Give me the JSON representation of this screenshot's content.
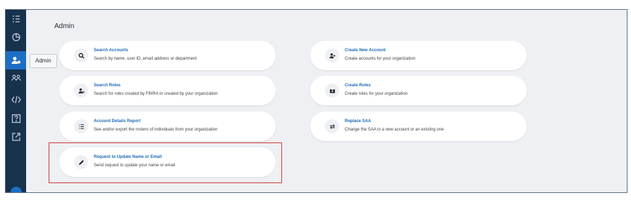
{
  "sidebar": {
    "items": [
      {
        "icon": "checklist-icon"
      },
      {
        "icon": "chart-pie-icon"
      },
      {
        "icon": "user-gear-icon",
        "active": true
      },
      {
        "icon": "users-icon"
      },
      {
        "icon": "code-icon"
      },
      {
        "icon": "help-box-icon"
      },
      {
        "icon": "external-link-icon"
      }
    ],
    "tooltip": "Admin"
  },
  "page": {
    "title": "Admin"
  },
  "cards": [
    {
      "title": "Search Accounts",
      "description": "Search by name, user ID, email address or department",
      "icon": "search-icon"
    },
    {
      "title": "Create New Account",
      "description": "Create accounts for your organization",
      "icon": "user-plus-icon"
    },
    {
      "title": "Search Roles",
      "description": "Search for roles created by FINRA or created by your organization",
      "icon": "user-search-icon"
    },
    {
      "title": "Create Roles",
      "description": "Create roles for your organization",
      "icon": "id-card-icon"
    },
    {
      "title": "Account Details Report",
      "description": "See and/or export the rosters of individuals from your organization",
      "icon": "list-icon"
    },
    {
      "title": "Replace SAA",
      "description": "Change the SAA to a new account or an existing one",
      "icon": "swap-icon"
    },
    {
      "title": "Request to Update Name or Email",
      "description": "Send request to update your name or email",
      "icon": "pencil-icon"
    }
  ],
  "colors": {
    "sidebar": "#17324d",
    "accent": "#1d6fc4",
    "link": "#1c6bb8",
    "highlight": "#cf3a3a"
  }
}
